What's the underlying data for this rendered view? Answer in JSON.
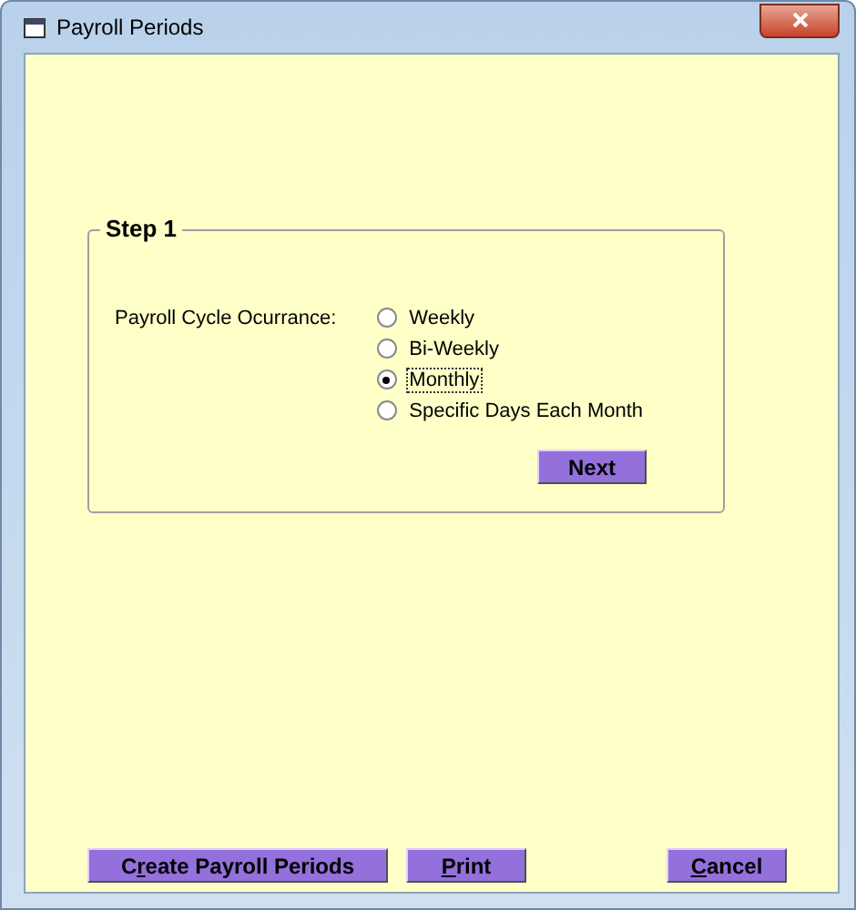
{
  "window": {
    "title": "Payroll Periods"
  },
  "step": {
    "title": "Step 1",
    "label": "Payroll Cycle Ocurrance:",
    "options": [
      {
        "label": "Weekly",
        "selected": false,
        "focused": false
      },
      {
        "label": "Bi-Weekly",
        "selected": false,
        "focused": false
      },
      {
        "label": "Monthly",
        "selected": true,
        "focused": true
      },
      {
        "label": "Specific Days Each Month",
        "selected": false,
        "focused": false
      }
    ],
    "next": {
      "after": "Next"
    }
  },
  "buttons": [
    {
      "before": "C",
      "key": "r",
      "after": "eate Payroll Periods"
    },
    {
      "key": "P",
      "after": "rint"
    },
    {
      "key": "C",
      "after": "ancel"
    }
  ]
}
